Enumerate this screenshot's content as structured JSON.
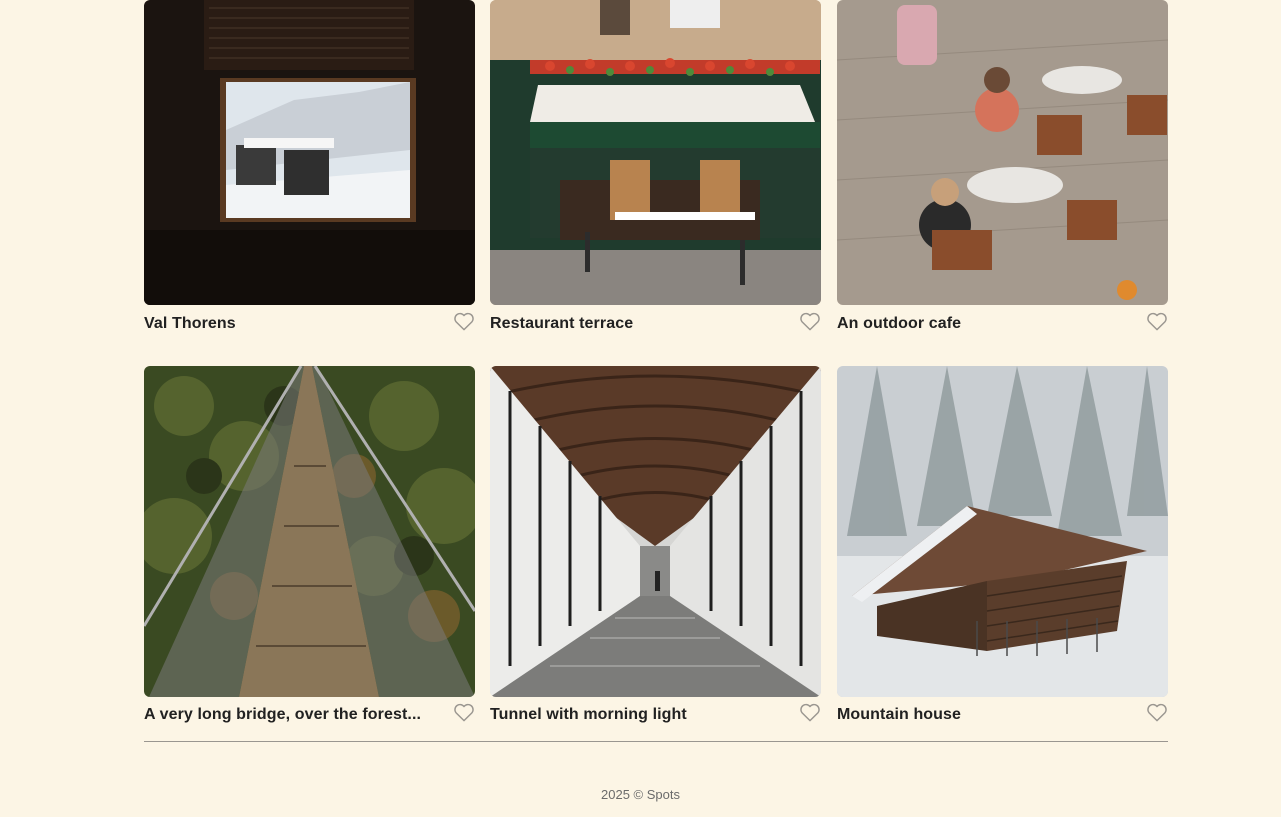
{
  "cards": [
    {
      "caption": "Val Thorens",
      "like_icon": "heart-outline-icon",
      "image": "view from a dark room window onto a snowy ski resort"
    },
    {
      "caption": "Restaurant terrace",
      "like_icon": "heart-outline-icon",
      "image": "restaurant front with green awning and flower boxes"
    },
    {
      "caption": "An outdoor cafe",
      "like_icon": "heart-outline-icon",
      "image": "people seated at small round tables on a paved terrace"
    },
    {
      "caption": "A very long bridge, over the forest...",
      "like_icon": "heart-outline-icon",
      "image": "suspension bridge over a forest valley"
    },
    {
      "caption": "Tunnel with morning light",
      "like_icon": "heart-outline-icon",
      "image": "glass walled passageway with arched wooden ceiling"
    },
    {
      "caption": "Mountain house",
      "like_icon": "heart-outline-icon",
      "image": "wooden barn in a snowy foggy forest"
    }
  ],
  "footer": {
    "text": "2025 © Spots"
  },
  "colors": {
    "background": "#fcf5e5",
    "text": "#212121",
    "icon": "#9a9690"
  }
}
